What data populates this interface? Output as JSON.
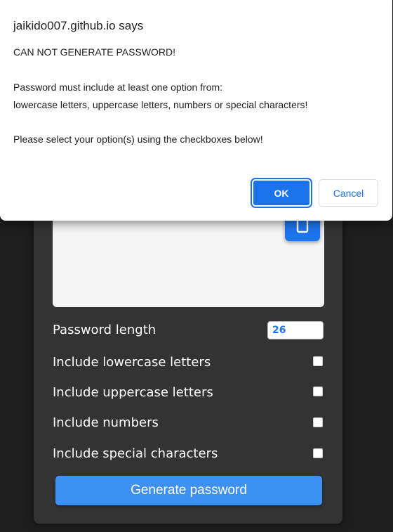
{
  "dialog": {
    "origin": "jaikido007.github.io says",
    "lines": [
      "CAN NOT GENERATE PASSWORD!",
      "Password must include at least one option from:",
      "lowercase letters, uppercase letters, numbers or special characters!",
      "Please select your option(s) using the checkboxes below!"
    ],
    "ok_label": "OK",
    "cancel_label": "Cancel"
  },
  "generator": {
    "output_value": "",
    "copy_icon": "clipboard-icon",
    "length_label": "Password length",
    "length_value": "26",
    "options": [
      {
        "label": "Include lowercase letters",
        "checked": false
      },
      {
        "label": "Include uppercase letters",
        "checked": false
      },
      {
        "label": "Include numbers",
        "checked": false
      },
      {
        "label": "Include special characters",
        "checked": false
      }
    ],
    "generate_label": "Generate password"
  },
  "colors": {
    "accent": "#1a73e8",
    "generate_button": "#3d91f5",
    "panel_bg": "#333333",
    "page_bg": "#1e1e1e"
  }
}
